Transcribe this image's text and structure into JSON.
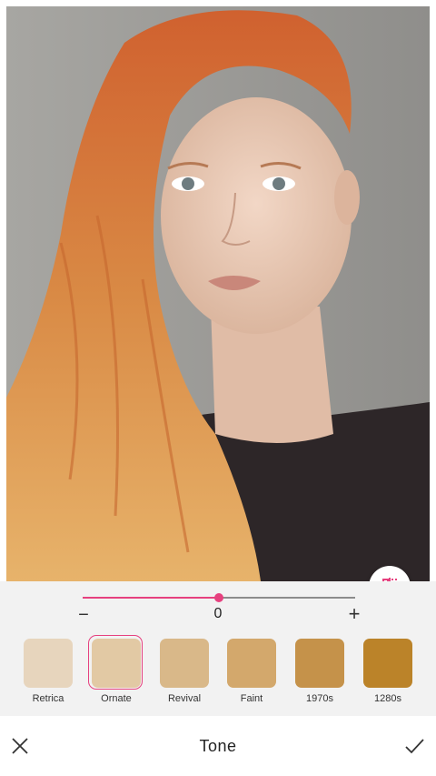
{
  "photo": {
    "subject": "portrait-photo"
  },
  "slider": {
    "value": "0",
    "fraction": 0.5,
    "minus": "−",
    "plus": "+"
  },
  "swatches": [
    {
      "label": "Retrica",
      "color": "#e7d5bd"
    },
    {
      "label": "Ornate",
      "color": "#e2c9a4",
      "selected": true
    },
    {
      "label": "Revival",
      "color": "#d9b889"
    },
    {
      "label": "Faint",
      "color": "#d3a86c"
    },
    {
      "label": "1970s",
      "color": "#c5924a"
    },
    {
      "label": "1280s",
      "color": "#bb8329"
    }
  ],
  "bottom_bar": {
    "title": "Tone"
  },
  "colors": {
    "accent": "#e6417f"
  }
}
